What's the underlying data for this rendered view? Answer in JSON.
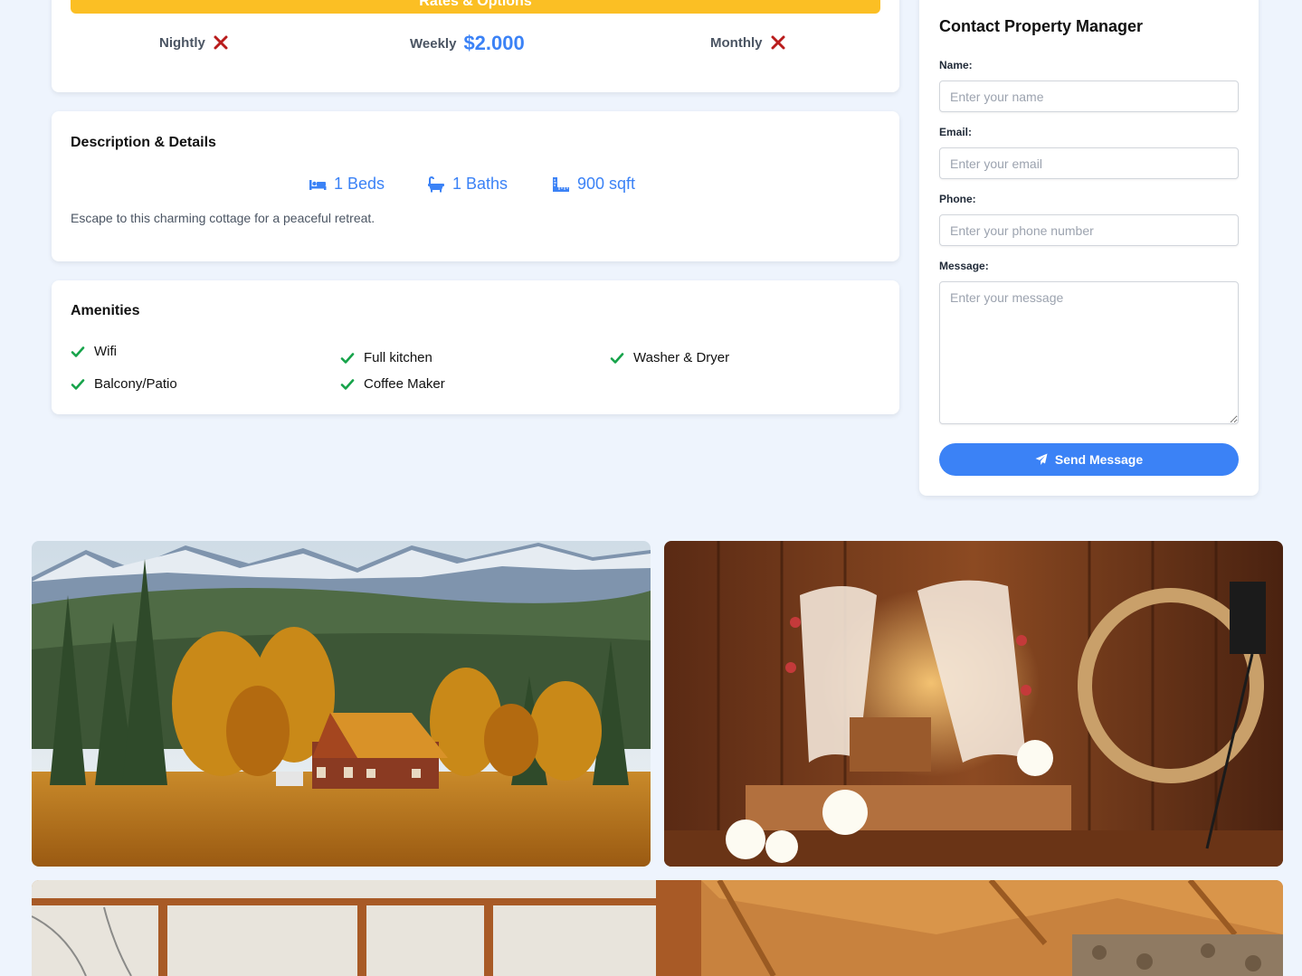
{
  "rates": {
    "bar_label": "Rates & Options",
    "nightly_label": "Nightly",
    "weekly_label": "Weekly",
    "weekly_value": "$2.000",
    "monthly_label": "Monthly"
  },
  "description": {
    "title": "Description & Details",
    "beds": "1 Beds",
    "baths": "1 Baths",
    "sqft": "900 sqft",
    "text": "Escape to this charming cottage for a peaceful retreat."
  },
  "amenities": {
    "title": "Amenities",
    "items": [
      "Wifi",
      "Full kitchen",
      "Washer & Dryer",
      "Balcony/Patio",
      "Coffee Maker"
    ]
  },
  "contact": {
    "title": "Contact Property Manager",
    "name_label": "Name:",
    "name_placeholder": "Enter your name",
    "email_label": "Email:",
    "email_placeholder": "Enter your email",
    "phone_label": "Phone:",
    "phone_placeholder": "Enter your phone number",
    "message_label": "Message:",
    "message_placeholder": "Enter your message",
    "send_label": "Send Message"
  },
  "colors": {
    "accent": "#3b82f6",
    "rates_bar": "#fbbf24",
    "unavailable": "#b91c1c",
    "check": "#16a34a"
  },
  "icons": [
    "x-icon",
    "bed-icon",
    "bath-icon",
    "ruler-icon",
    "check-icon",
    "paper-plane-icon"
  ]
}
